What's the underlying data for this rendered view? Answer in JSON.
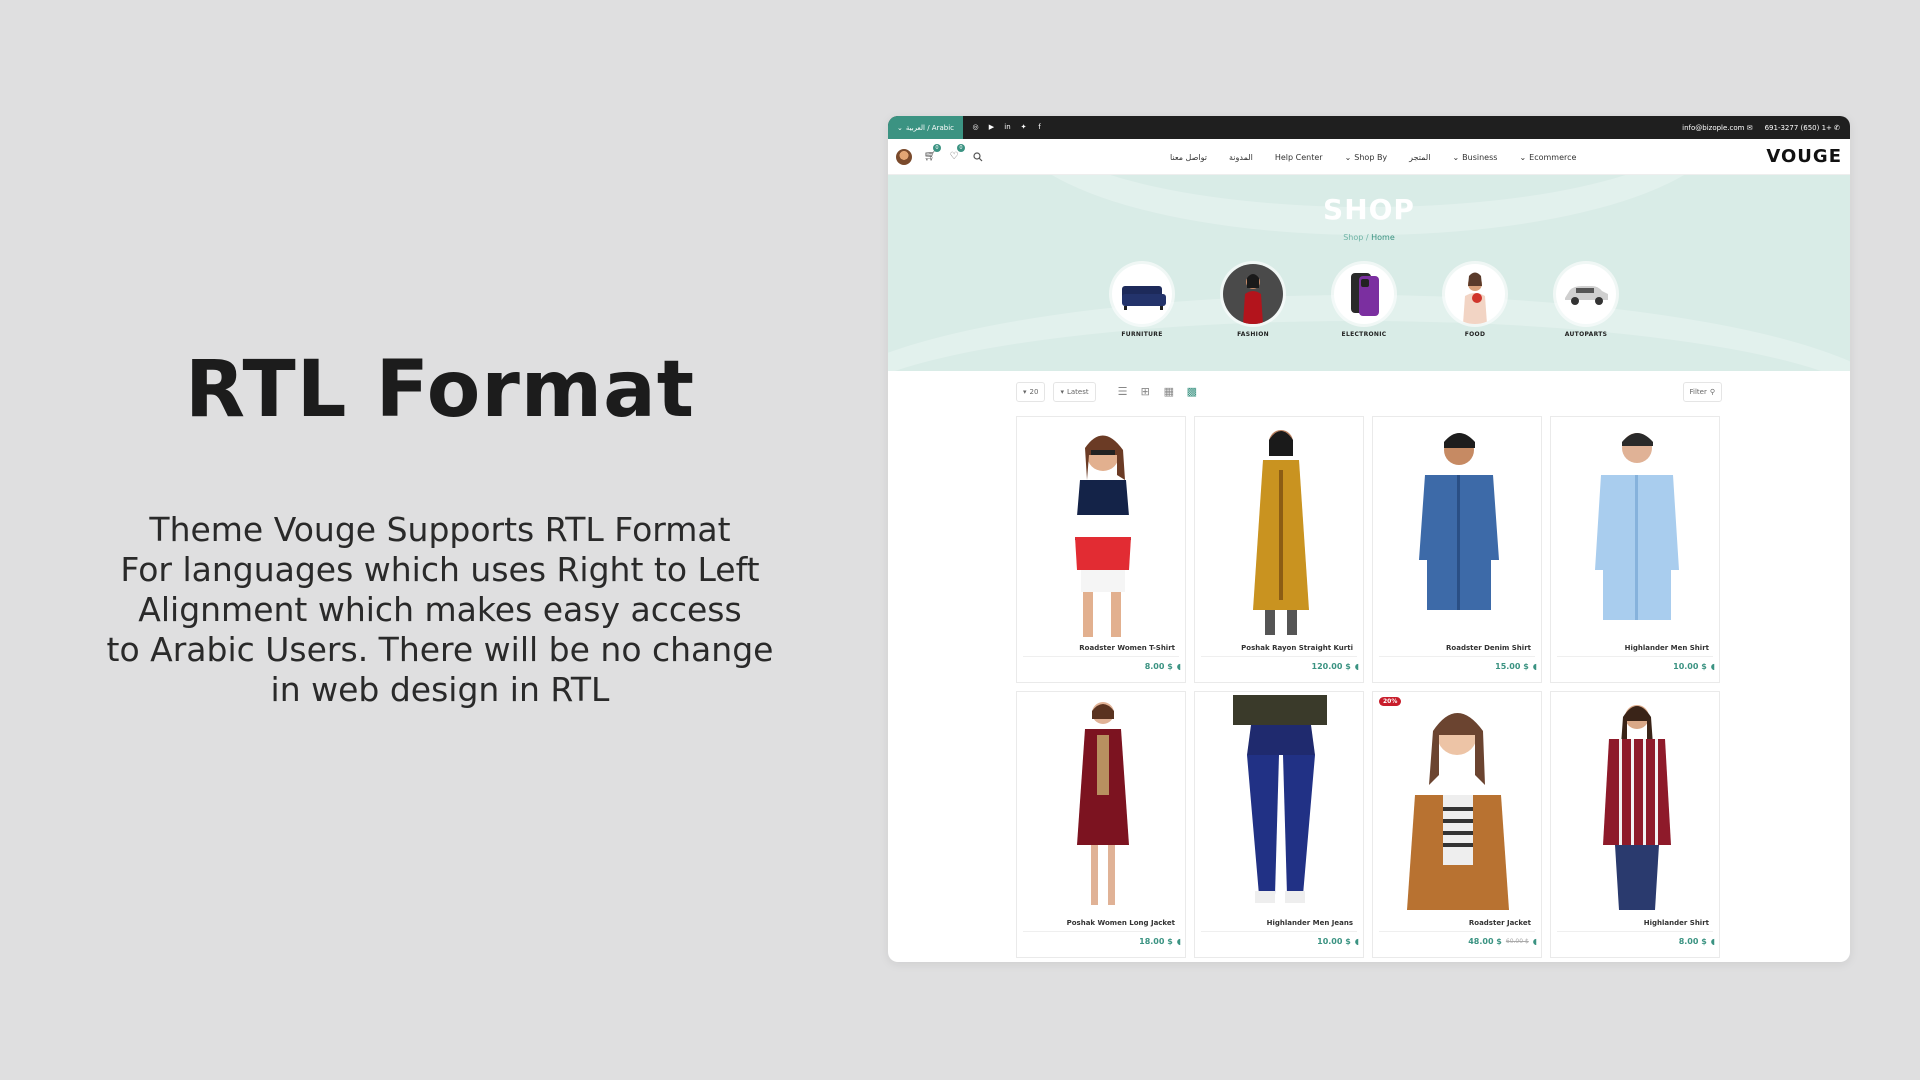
{
  "promo": {
    "title": "RTL Format",
    "lines": [
      "Theme Vouge Supports RTL Format",
      "For languages which uses Right to Left",
      "Alignment which makes easy access",
      "to Arabic Users. There will be no change",
      "in web design in RTL"
    ]
  },
  "topbar": {
    "language": "العربية / Arabic",
    "email": "info@bizople.com",
    "phone": "691-3277 (650) 1+",
    "social_icons": [
      "instagram-icon",
      "youtube-icon",
      "linkedin-icon",
      "twitter-icon",
      "facebook-icon"
    ]
  },
  "navbar": {
    "cart_count": "0",
    "wishlist_count": "0",
    "menu": [
      "تواصل معنا",
      "المدونة",
      "Help Center",
      "Shop By",
      "المتجر",
      "Business",
      "Ecommerce"
    ],
    "logo": "VOUGE"
  },
  "hero": {
    "title": "SHOP",
    "crumb_shop": "Shop",
    "crumb_sep": "/",
    "crumb_home": "Home",
    "categories": [
      "FURNITURE",
      "FASHION",
      "ELECTRONIC",
      "FOOD",
      "AUTOPARTS"
    ]
  },
  "toolbar": {
    "per_page": "20",
    "sort": "Latest",
    "filter": "Filter"
  },
  "products": [
    {
      "name": "Roadster Women T-Shirt",
      "price": "8.00 $"
    },
    {
      "name": "Poshak Rayon Straight Kurti",
      "price": "120.00 $"
    },
    {
      "name": "Roadster Denim Shirt",
      "price": "15.00 $"
    },
    {
      "name": "Highlander Men Shirt",
      "price": "10.00 $"
    },
    {
      "name": "Poshak Women Long Jacket",
      "price": "18.00 $"
    },
    {
      "name": "Highlander Men Jeans",
      "price": "10.00 $"
    },
    {
      "name": "Roadster Jacket",
      "price": "48.00 $",
      "old_price": "60.00 $",
      "badge": "20%"
    },
    {
      "name": "Highlander Shirt",
      "price": "8.00 $"
    }
  ],
  "colors": {
    "accent": "#3b9382",
    "hero_bg": "#d9ece7",
    "topbar_bg": "#1f1f1f",
    "sale_badge": "#c81d2b"
  }
}
